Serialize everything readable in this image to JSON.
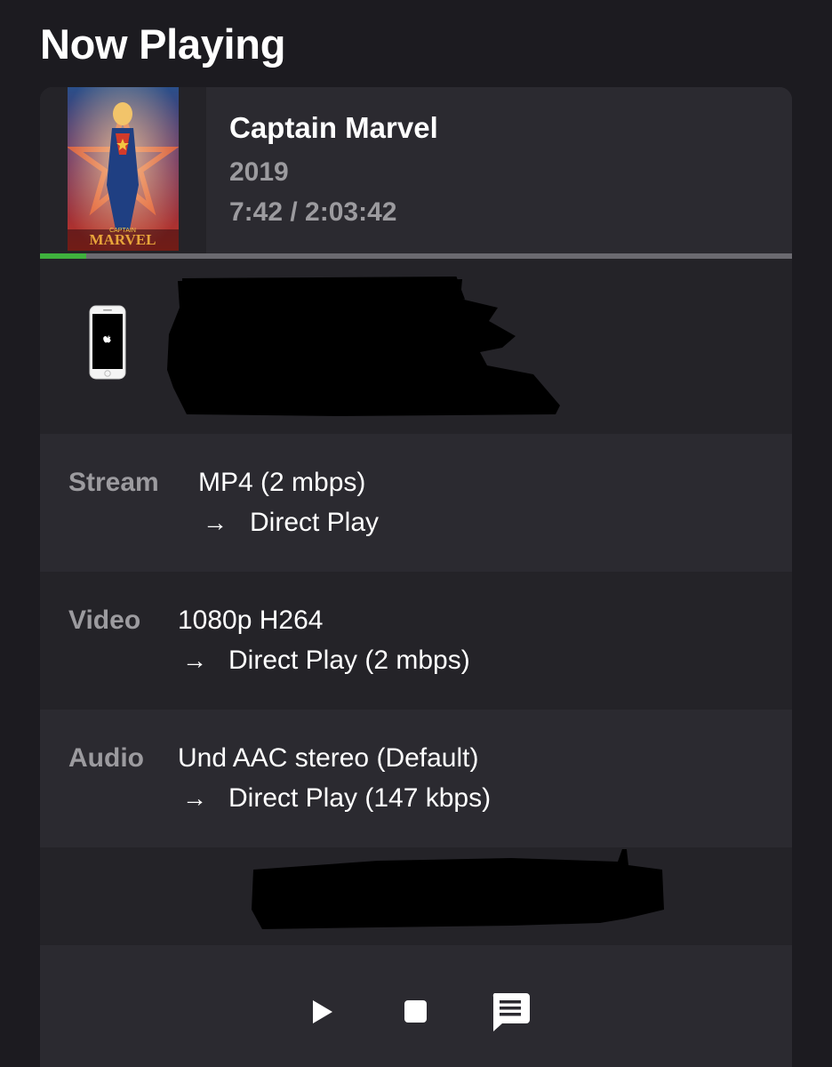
{
  "page": {
    "title": "Now Playing"
  },
  "media": {
    "title": "Captain Marvel",
    "year": "2019",
    "position": "7:42 / 2:03:42",
    "progress_fraction": 0.062,
    "poster_text": "MARVEL",
    "poster_text_small": "CAPTAIN"
  },
  "device": {
    "icon": "iphone-icon"
  },
  "stream": {
    "label": "Stream",
    "value": "MP4 (2 mbps)",
    "arrow": "→",
    "detail": "Direct Play"
  },
  "video": {
    "label": "Video",
    "value": "1080p H264",
    "arrow": "→",
    "detail": "Direct Play (2 mbps)"
  },
  "audio": {
    "label": "Audio",
    "value": "Und AAC stereo (Default)",
    "arrow": "→",
    "detail": "Direct Play (147 kbps)"
  },
  "controls": {
    "play_icon": "play-icon",
    "stop_icon": "stop-icon",
    "subtitles_icon": "subtitles-icon"
  },
  "colors": {
    "background": "#1c1b20",
    "card": "#2b2a30",
    "card_alt": "#242328",
    "muted_text": "#9c9b9f",
    "progress": "#3fb13d"
  }
}
